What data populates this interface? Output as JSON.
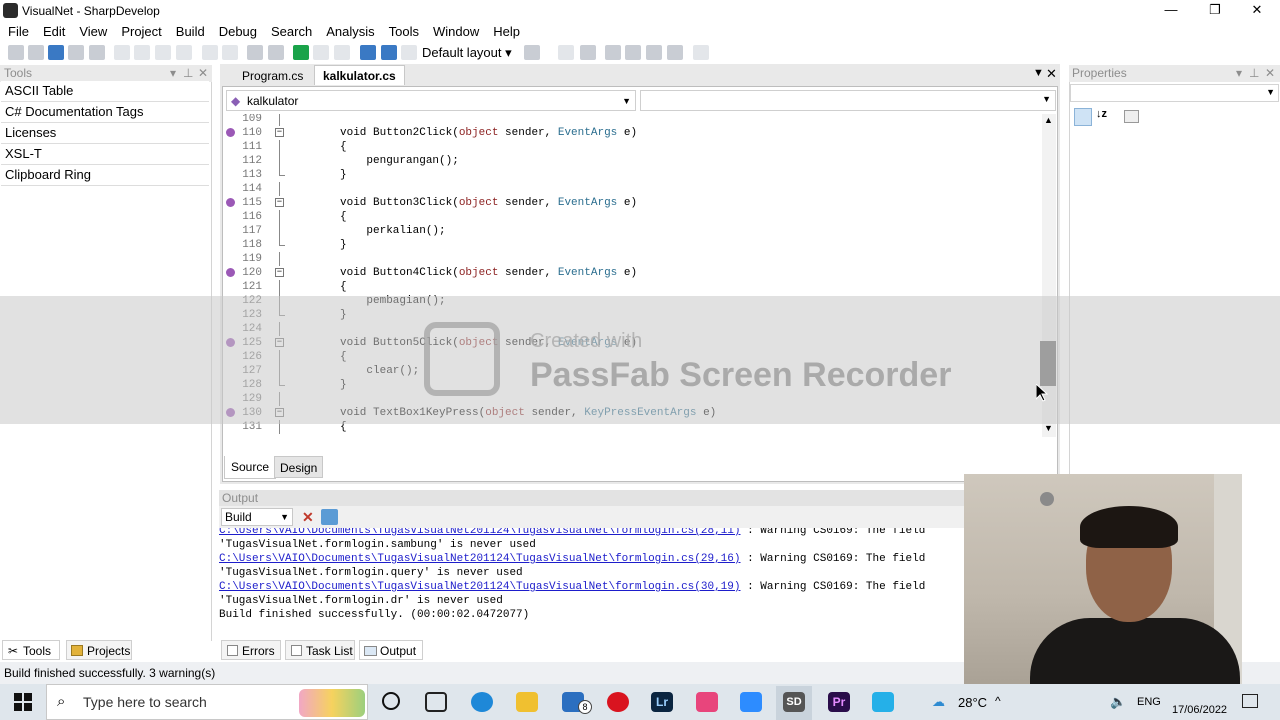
{
  "window": {
    "title": "VisualNet - SharpDevelop",
    "controls": [
      "—",
      "❐",
      "✕"
    ]
  },
  "menu": [
    "File",
    "Edit",
    "View",
    "Project",
    "Build",
    "Debug",
    "Search",
    "Analysis",
    "Tools",
    "Window",
    "Help"
  ],
  "toolbar": {
    "layout_select": "Default layout"
  },
  "tools_panel": {
    "title": "Tools",
    "items": [
      "ASCII Table",
      "C# Documentation Tags",
      "Licenses",
      "XSL-T",
      "Clipboard Ring"
    ]
  },
  "editor": {
    "tabs": [
      "Program.cs",
      "kalkulator.cs"
    ],
    "active_tab": "kalkulator.cs",
    "class_dropdown": "kalkulator",
    "member_dropdown": "",
    "lines": [
      {
        "n": "109",
        "code": ""
      },
      {
        "n": "110",
        "code": "void Button2Click(object sender, EventArgs e)",
        "fold": true
      },
      {
        "n": "111",
        "code": "{"
      },
      {
        "n": "112",
        "code": "    pengurangan();"
      },
      {
        "n": "113",
        "code": "}"
      },
      {
        "n": "114",
        "code": ""
      },
      {
        "n": "115",
        "code": "void Button3Click(object sender, EventArgs e)",
        "fold": true
      },
      {
        "n": "116",
        "code": "{"
      },
      {
        "n": "117",
        "code": "    perkalian();"
      },
      {
        "n": "118",
        "code": "}"
      },
      {
        "n": "119",
        "code": ""
      },
      {
        "n": "120",
        "code": "void Button4Click(object sender, EventArgs e)",
        "fold": true
      },
      {
        "n": "121",
        "code": "{"
      },
      {
        "n": "122",
        "code": "    pembagian();"
      },
      {
        "n": "123",
        "code": "}"
      },
      {
        "n": "124",
        "code": ""
      },
      {
        "n": "125",
        "code": "void Button5Click(object sender, EventArgs e)",
        "fold": true
      },
      {
        "n": "126",
        "code": "{"
      },
      {
        "n": "127",
        "code": "    clear();"
      },
      {
        "n": "128",
        "code": "}"
      },
      {
        "n": "129",
        "code": ""
      },
      {
        "n": "130",
        "code": "void TextBox1KeyPress(object sender, KeyPressEventArgs e)",
        "fold": true
      },
      {
        "n": "131",
        "code": "{"
      }
    ],
    "bottom_tabs": [
      "Source",
      "Design"
    ]
  },
  "watermark": {
    "line1": "Created with",
    "line2": "PassFab Screen Recorder"
  },
  "properties_panel": {
    "title": "Properties"
  },
  "output": {
    "title": "Output",
    "source": "Build",
    "lines": [
      {
        "link": "C:\\Users\\VAIO\\Documents\\TugasVisualNet201124\\TugasVisualNet\\formlogin.cs(28,11)",
        "text": " : Warning CS0169: The field"
      },
      {
        "text": "'TugasVisualNet.formlogin.sambung' is never used"
      },
      {
        "link": "C:\\Users\\VAIO\\Documents\\TugasVisualNet201124\\TugasVisualNet\\formlogin.cs(29,16)",
        "text": " : Warning CS0169: The field"
      },
      {
        "text": "'TugasVisualNet.formlogin.query' is never used"
      },
      {
        "link": "C:\\Users\\VAIO\\Documents\\TugasVisualNet201124\\TugasVisualNet\\formlogin.cs(30,19)",
        "text": " : Warning CS0169: The field"
      },
      {
        "text": "'TugasVisualNet.formlogin.dr' is never used"
      },
      {
        "text": "Build finished successfully. (00:00:02.0472077)"
      }
    ],
    "tabs": [
      "Errors",
      "Task List",
      "Output"
    ],
    "active_tab": "Output"
  },
  "left_bottom_tabs": [
    "Tools",
    "Projects"
  ],
  "status": "Build finished successfully. 3 warning(s)",
  "taskbar": {
    "search_placeholder": "Type here to search",
    "weather": "28°C",
    "lang": "ENG",
    "date": "17/06/2022",
    "mail_badge": "8"
  }
}
